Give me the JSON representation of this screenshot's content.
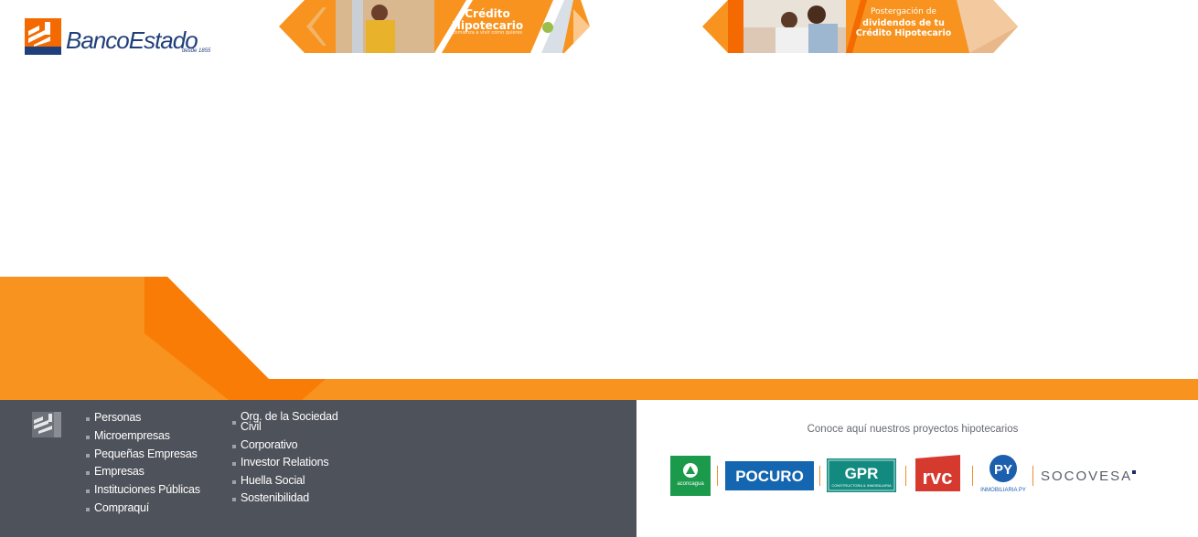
{
  "header": {
    "logo_text": "BancoEstado",
    "logo_since": "desde 1855",
    "banner1": {
      "title_line1": "Crédito",
      "title_line2": "Hipotecario",
      "subtitle": "comienza a vivir como quieres"
    },
    "banner2": {
      "pre": "Postergación de",
      "title_line1": "dividendos de tu",
      "title_line2": "Crédito Hipotecario"
    }
  },
  "footer": {
    "links_col1": [
      "Personas",
      "Microempresas",
      "Pequeñas Empresas",
      "Empresas",
      "Instituciones Públicas",
      "Compraquí"
    ],
    "links_col2": [
      "Org. de la Sociedad Civil",
      "Corporativo",
      "Investor Relations",
      "Huella Social",
      "Sostenibilidad"
    ],
    "projects_title": "Conoce aquí nuestros proyectos hipotecarios",
    "brands": {
      "aconcagua": "aconcagua",
      "pocuro": "POCURO",
      "gpr": "GPR",
      "gpr_sub": "CONSTRUCTORA & INMOBILIARIA",
      "rvc": "rvc",
      "py": "PY",
      "py_sub": "INMOBILIARIA PY",
      "socovesa": "SOCOVESA"
    }
  },
  "colors": {
    "brand_orange": "#f7931e",
    "dark_orange": "#f56a00",
    "footer_dark": "#4e525a",
    "brand_blue": "#1f3f7a"
  }
}
